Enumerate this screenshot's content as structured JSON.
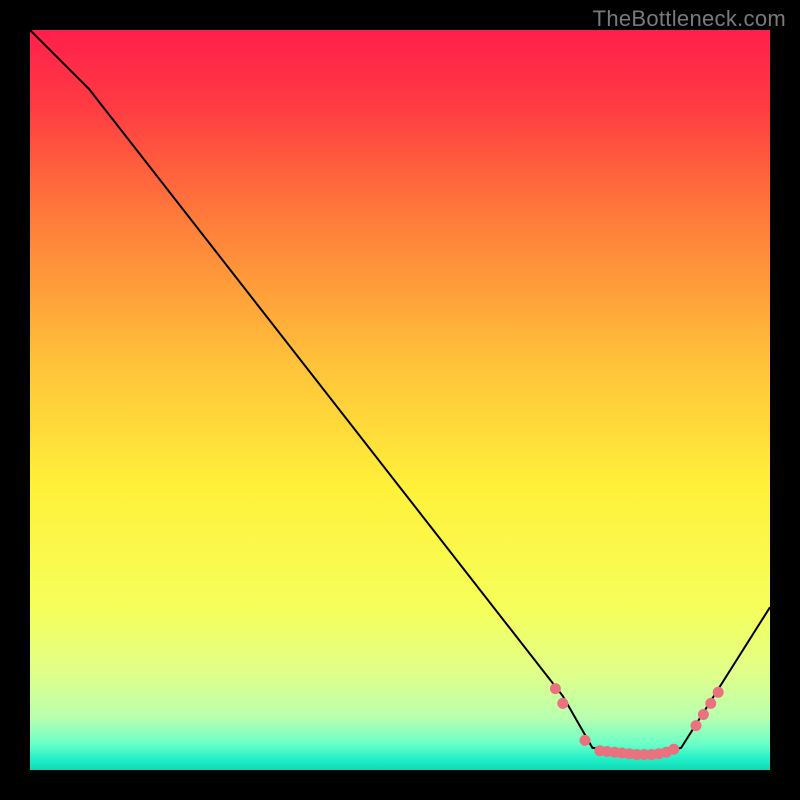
{
  "watermark": "TheBottleneck.com",
  "chart_data": {
    "type": "line",
    "title": "",
    "xlabel": "",
    "ylabel": "",
    "xlim": [
      0,
      100
    ],
    "ylim": [
      0,
      100
    ],
    "series": [
      {
        "name": "curve",
        "x": [
          0,
          8,
          72,
          76,
          84,
          88,
          100
        ],
        "y": [
          100,
          92,
          10,
          3,
          2,
          3,
          22
        ]
      }
    ],
    "markers": {
      "name": "dots",
      "color": "#e9727e",
      "points": [
        {
          "x": 71,
          "y": 11
        },
        {
          "x": 72,
          "y": 9
        },
        {
          "x": 75,
          "y": 4
        },
        {
          "x": 77,
          "y": 2.6
        },
        {
          "x": 78,
          "y": 2.5
        },
        {
          "x": 79,
          "y": 2.4
        },
        {
          "x": 80,
          "y": 2.3
        },
        {
          "x": 81,
          "y": 2.2
        },
        {
          "x": 82,
          "y": 2.1
        },
        {
          "x": 83,
          "y": 2.1
        },
        {
          "x": 84,
          "y": 2.1
        },
        {
          "x": 85,
          "y": 2.2
        },
        {
          "x": 86,
          "y": 2.4
        },
        {
          "x": 87,
          "y": 2.8
        },
        {
          "x": 90,
          "y": 6
        },
        {
          "x": 91,
          "y": 7.5
        },
        {
          "x": 92,
          "y": 9
        },
        {
          "x": 93,
          "y": 10.5
        }
      ]
    },
    "gradient_stops": [
      {
        "offset": 0.0,
        "color": "#ff1f4b"
      },
      {
        "offset": 0.1,
        "color": "#ff3a43"
      },
      {
        "offset": 0.25,
        "color": "#ff7a3a"
      },
      {
        "offset": 0.45,
        "color": "#ffc23a"
      },
      {
        "offset": 0.62,
        "color": "#fff13a"
      },
      {
        "offset": 0.78,
        "color": "#f6ff5a"
      },
      {
        "offset": 0.87,
        "color": "#e0ff8a"
      },
      {
        "offset": 0.93,
        "color": "#b8ffb0"
      },
      {
        "offset": 0.965,
        "color": "#6affc8"
      },
      {
        "offset": 0.985,
        "color": "#22f0c8"
      },
      {
        "offset": 1.0,
        "color": "#0fd8b8"
      }
    ]
  }
}
